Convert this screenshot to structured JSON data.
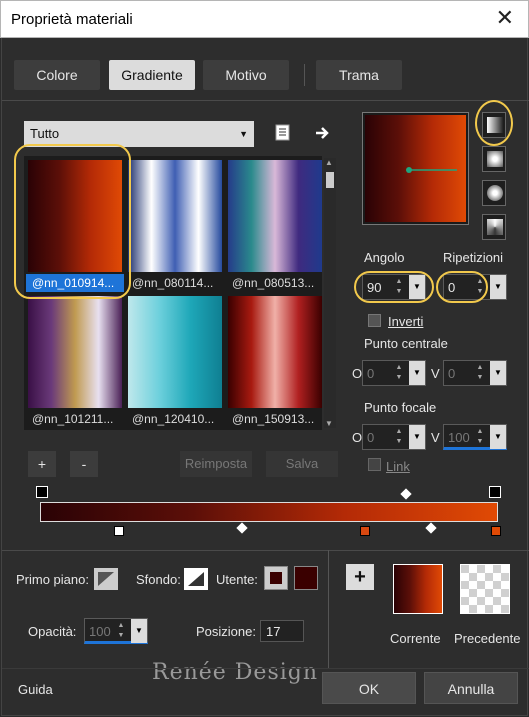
{
  "window": {
    "title": "Proprietà materiali",
    "close_glyph": "✕"
  },
  "tabs": [
    {
      "label": "Colore",
      "active": false
    },
    {
      "label": "Gradiente",
      "active": true
    },
    {
      "label": "Motivo",
      "active": false
    },
    {
      "label": "Trama",
      "active": false
    }
  ],
  "category": {
    "selected": "Tutto"
  },
  "gradients": [
    {
      "caption": "@nn_010914...",
      "selected": true,
      "colors": [
        "#2a0205",
        "#5c0f08",
        "#b42a06",
        "#e04a05"
      ]
    },
    {
      "caption": "@nn_080114...",
      "selected": false,
      "colors": [
        "#1c2f6e",
        "#ffffff",
        "#3f5fb3",
        "#ffffff",
        "#254a9e"
      ]
    },
    {
      "caption": "@nn_080513...",
      "selected": false,
      "colors": [
        "#253b8a",
        "#2a8a8c",
        "#d9b8d8",
        "#3f2a7f",
        "#1f3a8c"
      ]
    },
    {
      "caption": "@nn_101211...",
      "selected": false,
      "colors": [
        "#3a1046",
        "#6a3a7a",
        "#c09a50",
        "#e8e0f0",
        "#4a2056"
      ]
    },
    {
      "caption": "@nn_120410...",
      "selected": false,
      "colors": [
        "#bfe8ec",
        "#6dd0dc",
        "#1ea7b8",
        "#0f7f92"
      ]
    },
    {
      "caption": "@nn_150913...",
      "selected": false,
      "colors": [
        "#3a0000",
        "#a81a10",
        "#f0b0a8",
        "#b02020",
        "#3a0000"
      ]
    }
  ],
  "buttons": {
    "add": "+",
    "remove": "-",
    "reset": "Reimposta",
    "save": "Salva"
  },
  "angle": {
    "label": "Angolo",
    "value": "90"
  },
  "repeats": {
    "label": "Ripetizioni",
    "value": "0"
  },
  "invert": {
    "label": "Inverti",
    "checked": false
  },
  "center_point": {
    "label": "Punto centrale",
    "h_label": "O",
    "h_value": "0",
    "v_label": "V",
    "v_value": "0"
  },
  "focal_point": {
    "label": "Punto focale",
    "h_label": "O",
    "h_value": "0",
    "v_label": "V",
    "v_value": "100"
  },
  "link": {
    "label": "Link"
  },
  "bottom": {
    "foreground_label": "Primo piano:",
    "background_label": "Sfondo:",
    "user_label": "Utente:",
    "user_color": "#3a0000",
    "opacity_label": "Opacità:",
    "opacity_value": "100",
    "position_label": "Posizione:",
    "position_value": "17",
    "current_label": "Corrente",
    "previous_label": "Precedente",
    "add_glyph": "+"
  },
  "watermark": "Renée Design",
  "footer": {
    "help": "Guida",
    "ok": "OK",
    "cancel": "Annulla"
  },
  "colors": {
    "gradient_start": "#2a0205",
    "gradient_end": "#e04a05",
    "selection": "#1e74d8",
    "highlight": "#f2c94c"
  }
}
